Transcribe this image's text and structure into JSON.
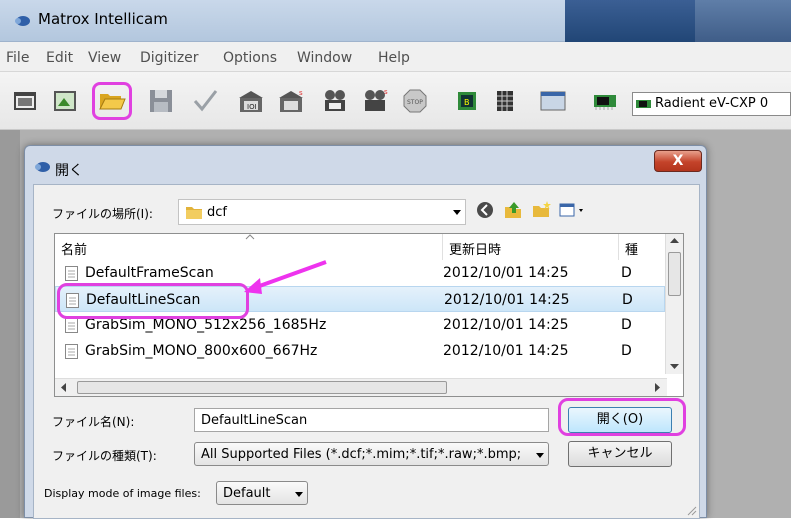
{
  "window": {
    "title": "Matrox Intellicam"
  },
  "menu": [
    "File",
    "Edit",
    "View",
    "Digitizer",
    "Options",
    "Window",
    "Help"
  ],
  "toolbar": {
    "tools": [
      "camera-icon",
      "image-icon",
      "open-folder-icon",
      "save-icon",
      "check-icon",
      "grab-icon",
      "grab-sequence-icon",
      "film-icon",
      "film-sequence-icon",
      "stop-icon",
      "board-icon",
      "grid-icon",
      "display-icon",
      "chip-icon"
    ],
    "camera_select": "Radient eV-CXP 0"
  },
  "dialog": {
    "title": "開く",
    "close_label": "X",
    "location_label": "ファイルの場所(I):",
    "location_value": "dcf",
    "columns": {
      "name": "名前",
      "date": "更新日時",
      "type": "種"
    },
    "files": [
      {
        "name": "DefaultFrameScan",
        "date": "2012/10/01 14:25",
        "type": "D",
        "selected": false
      },
      {
        "name": "DefaultLineScan",
        "date": "2012/10/01 14:25",
        "type": "D",
        "selected": true
      },
      {
        "name": "GrabSim_MONO_512x256_1685Hz",
        "date": "2012/10/01 14:25",
        "type": "D",
        "selected": false
      },
      {
        "name": "GrabSim_MONO_800x600_667Hz",
        "date": "2012/10/01 14:25",
        "type": "D",
        "selected": false
      }
    ],
    "filename_label": "ファイル名(N):",
    "filename_value": "DefaultLineScan",
    "filetype_label": "ファイルの種類(T):",
    "filetype_value": "All Supported Files (*.dcf;*.mim;*.tif;*.raw;*.bmp;",
    "open_button": "開く(O)",
    "cancel_button": "キャンセル",
    "display_mode_label": "Display mode of image files:",
    "display_mode_value": "Default"
  },
  "colors": {
    "highlight": "#e040e0",
    "titlebar": "#c9d8ea",
    "selection": "#cde6f8"
  }
}
